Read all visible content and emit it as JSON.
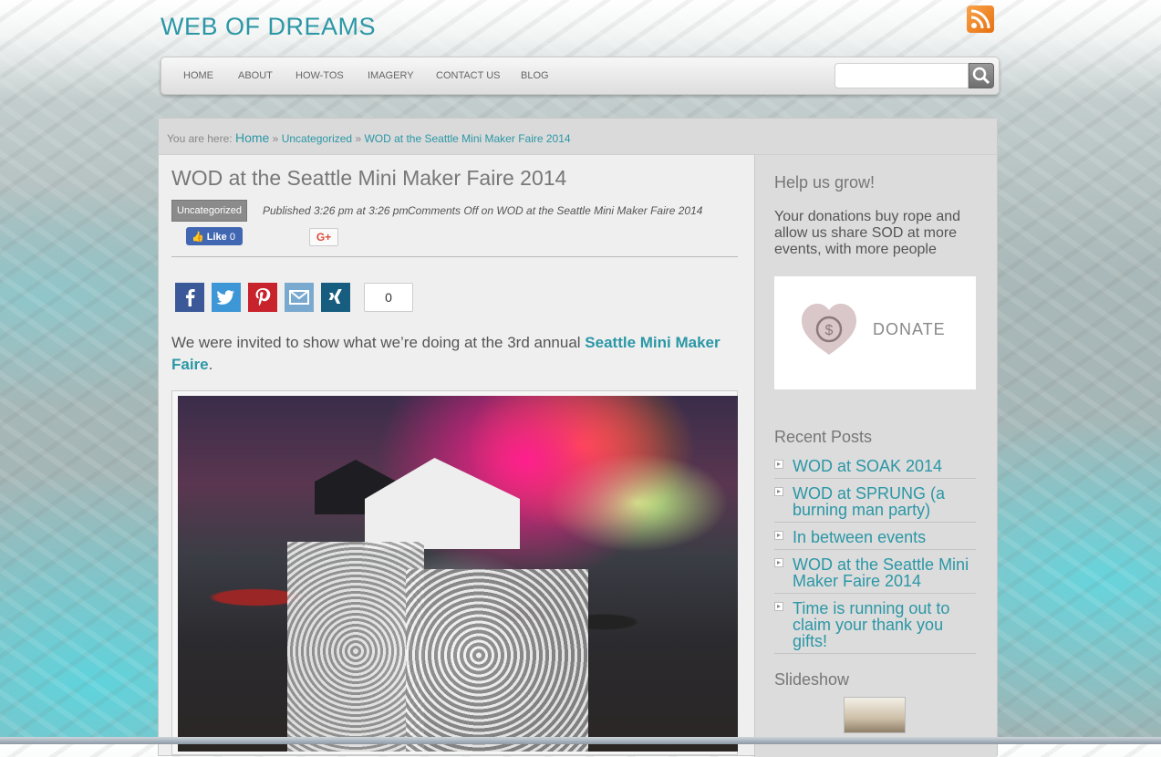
{
  "site": {
    "title": "WEB OF DREAMS",
    "rss_icon": "rss-icon"
  },
  "nav": {
    "items": [
      "HOME",
      "ABOUT",
      "HOW-TOS",
      "IMAGERY",
      "CONTACT US",
      "BLOG"
    ],
    "search_value": "",
    "search_icon": "magnifier-icon"
  },
  "breadcrumb": {
    "prefix": "You are here:",
    "home": "Home",
    "sep1": "»",
    "category": "Uncategorized",
    "sep2": "»",
    "current": "WOD at the Seattle Mini Maker Faire 2014"
  },
  "post": {
    "title": "WOD at the Seattle Mini Maker Faire 2014",
    "category": "Uncategorized",
    "published": "Published 3:26 pm at 3:26 pm",
    "comments": "Comments Off on WOD at the Seattle Mini Maker Faire 2014",
    "fb_like": "Like",
    "fb_count": "0",
    "gplus": "G+",
    "share_count": "0",
    "intro_before": "We were invited to show what we’re doing at the 3rd annual ",
    "intro_link": "Seattle Mini Maker Faire",
    "intro_after": "."
  },
  "share_buttons": [
    {
      "name": "facebook",
      "color": "#3b5998"
    },
    {
      "name": "twitter",
      "color": "#3d97d6"
    },
    {
      "name": "pinterest",
      "color": "#c8232c"
    },
    {
      "name": "email",
      "color": "#7aa9d0"
    },
    {
      "name": "xing",
      "color": "#175d7f"
    }
  ],
  "sidebar": {
    "help_title": "Help us grow!",
    "help_text": "Your donations buy rope and allow us share SOD at more events, with more people",
    "donate_label": "DONATE",
    "recent_title": "Recent Posts",
    "recent_posts": [
      "WOD at SOAK 2014",
      "WOD at SPRUNG (a burning man party)",
      "In between events",
      "WOD at the Seattle Mini Maker Faire 2014",
      "Time is running out to claim your thank you gifts!"
    ],
    "slideshow_title": "Slideshow"
  },
  "colors": {
    "accent": "#2b97a6",
    "text": "#555555"
  }
}
